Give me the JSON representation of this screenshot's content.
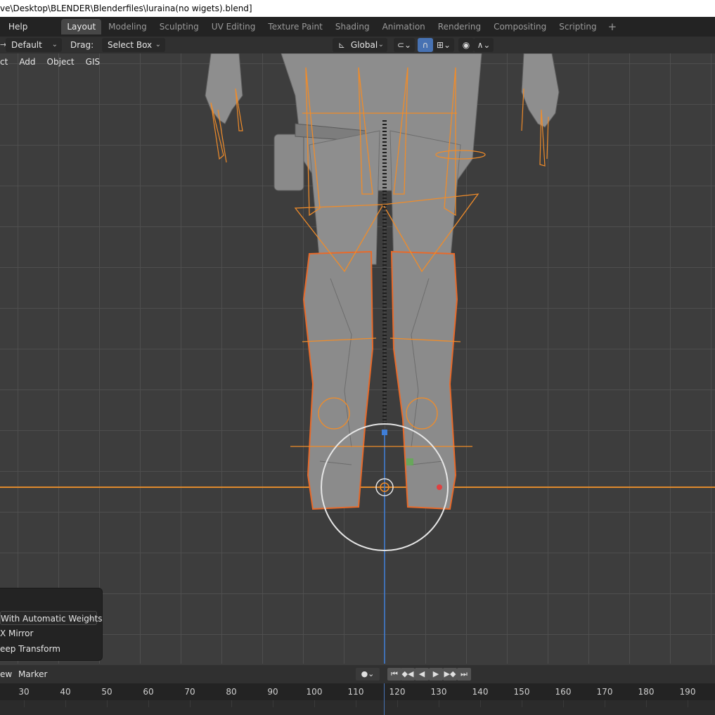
{
  "window": {
    "title": "ve\\Desktop\\BLENDER\\Blenderfiles\\luraina(no wigets).blend]"
  },
  "menubar": {
    "help": "Help",
    "workspaces": [
      "Layout",
      "Modeling",
      "Sculpting",
      "UV Editing",
      "Texture Paint",
      "Shading",
      "Animation",
      "Rendering",
      "Compositing",
      "Scripting"
    ],
    "active_workspace": "Layout",
    "add_tab": "+"
  },
  "tool_header": {
    "orientation_label": "Default",
    "drag_label": "Drag:",
    "drag_value": "Select Box",
    "transform_orientation": "Global",
    "icons": {
      "orientation": "arrow-icon",
      "global": "transform-orientation-icon",
      "pivot": "pivot-point-icon",
      "snap": "snap-magnet-icon",
      "snap_target": "snap-increment-icon",
      "proportional": "proportional-edit-icon",
      "falloff": "falloff-curve-icon"
    }
  },
  "viewport_header": {
    "items": [
      "ct",
      "Add",
      "Object",
      "GIS"
    ]
  },
  "operator_panel": {
    "parent_option": "With Automatic Weights",
    "x_mirror": "X Mirror",
    "keep_transform": "eep Transform"
  },
  "timeline": {
    "menus": [
      "ew",
      "Marker"
    ],
    "frames": [
      "30",
      "40",
      "50",
      "60",
      "70",
      "80",
      "90",
      "100",
      "110",
      "120",
      "130",
      "140",
      "150",
      "160",
      "170",
      "180",
      "190"
    ]
  },
  "colors": {
    "accent": "#4772b3",
    "selection_orange": "#f08c2a",
    "background": "#3d3d3d"
  }
}
